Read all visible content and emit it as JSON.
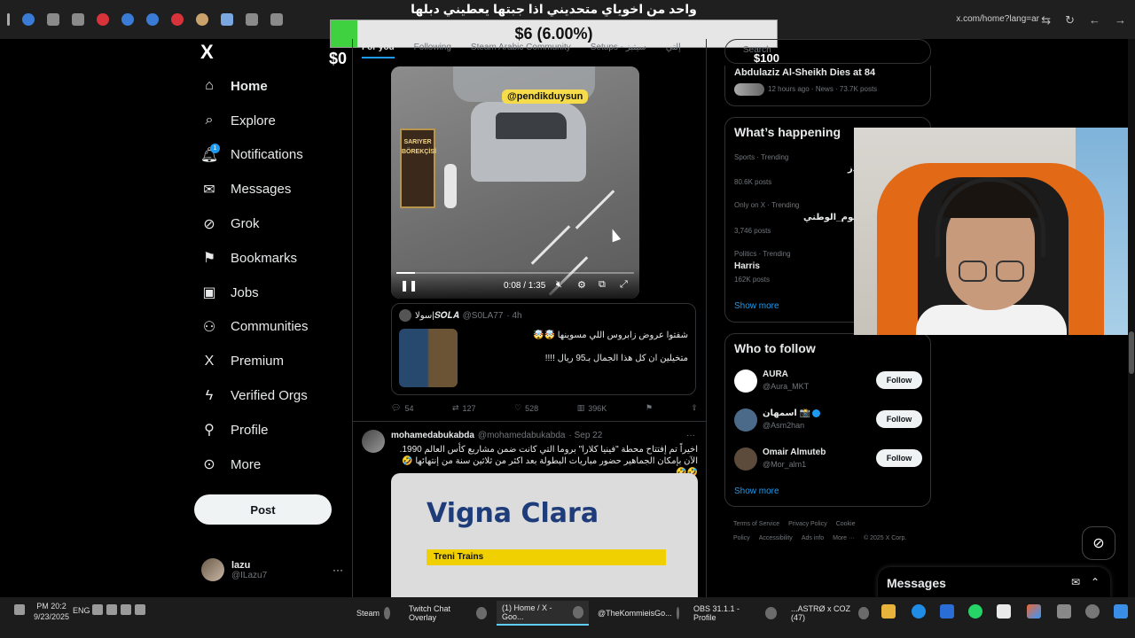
{
  "browser": {
    "url": "x.com/home?lang=ar",
    "stream_title": "واحد من اخوياي متحديني اذا جبتها يعطيني دبلها"
  },
  "goal": {
    "label": "$6 (6.00%)",
    "percent": 6,
    "min_label": "$0",
    "max_label": "$100"
  },
  "nav": {
    "logo": "X",
    "items": [
      {
        "label": "Home",
        "icon": "home-icon",
        "glyph": "⌂"
      },
      {
        "label": "Explore",
        "icon": "search-icon",
        "glyph": "⌕"
      },
      {
        "label": "Notifications",
        "icon": "bell-icon",
        "glyph": "🔔︎"
      },
      {
        "label": "Messages",
        "icon": "mail-icon",
        "glyph": "✉"
      },
      {
        "label": "Grok",
        "icon": "grok-icon",
        "glyph": "⊘"
      },
      {
        "label": "Bookmarks",
        "icon": "bookmark-icon",
        "glyph": "⚑"
      },
      {
        "label": "Jobs",
        "icon": "briefcase-icon",
        "glyph": "▣"
      },
      {
        "label": "Communities",
        "icon": "people-icon",
        "glyph": "⚇"
      },
      {
        "label": "Premium",
        "icon": "x-premium-icon",
        "glyph": "X"
      },
      {
        "label": "Verified Orgs",
        "icon": "lightning-icon",
        "glyph": "ϟ"
      },
      {
        "label": "Profile",
        "icon": "person-icon",
        "glyph": "⚲"
      },
      {
        "label": "More",
        "icon": "more-circle-icon",
        "glyph": "⊙"
      }
    ],
    "notification_badge": "1",
    "post_button": "Post",
    "account_name": "lazu",
    "account_handle": "@ILazu7",
    "account_more": "···"
  },
  "feed": {
    "tabs": [
      "For you",
      "Following",
      "Steam Arabic Community",
      "Setups - سيتبز",
      "إلتي"
    ],
    "video": {
      "watermark": "@pendikduysun",
      "sign": "SARIYER BÖREKÇİSİ",
      "time": "0:08 / 1:35",
      "progress": 0.08
    },
    "quote": {
      "name": "سولا|𝑺𝑶𝑳𝑨",
      "handle": "@S0LA77",
      "time": "· 4h",
      "line1": "شفتوا عروض زابروس اللي مسوينها 🤯🤯",
      "line2": "متخيلين ان كل هذا الجمال بـ95 ريال !!!!"
    },
    "actions": {
      "replies": "54",
      "reposts": "127",
      "likes": "528",
      "views": "396K"
    },
    "post2": {
      "name": "mohamedabukabda",
      "handle": "@mohamedabukabda",
      "date": "· Sep 22",
      "more": "···",
      "body": "اخيراً تم إفتتاح محطة \"فينيا كلارا\" بروما التي كانت ضمن مشاريع كأس العالم 1990. الآن بإمكان الجماهير حضور مباريات البطولة بعد اكثر من ثلاثين سنة من إنتهائها 🤣🤣🤣",
      "image_text": "Vigna Clara",
      "image_band": "Treni  Trains"
    }
  },
  "sidebar": {
    "search_placeholder": "Search",
    "news": {
      "title": "Abdulaziz Al-Sheikh Dies at 84",
      "meta": "12 hours ago · News · 73.7K posts"
    },
    "happening": {
      "title": "What’s happening",
      "trends": [
        {
          "category": "Sports · Trending",
          "name": "دز",
          "posts": "80.6K posts"
        },
        {
          "category": "Only on X · Trending",
          "name": "يوم_الوطني",
          "posts": "3,746 posts"
        },
        {
          "category": "Politics · Trending",
          "name": "Harris",
          "posts": "162K posts"
        }
      ],
      "show_more": "Show more"
    },
    "who_to_follow": {
      "title": "Who to follow",
      "accounts": [
        {
          "name": "AURA",
          "handle": "@Aura_MKT",
          "button": "Follow"
        },
        {
          "name": "اسمهان 📸",
          "handle": "@Asm2han",
          "button": "Follow"
        },
        {
          "name": "Omair Almuteb",
          "handle": "@Mor_alm1",
          "button": "Follow"
        }
      ],
      "show_more": "Show more"
    },
    "footer": [
      "Terms of Service",
      "Privacy Policy",
      "Cookie Policy",
      "Accessibility",
      "Ads info",
      "More ···",
      "© 2025 X Corp."
    ]
  },
  "messages_dock": {
    "title": "Messages"
  },
  "taskbar": {
    "time": "PM 20:2",
    "date": "9/23/2025",
    "lang": "ENG",
    "tasks": [
      {
        "label": "Steam"
      },
      {
        "label": "Twitch Chat Overlay"
      },
      {
        "label": "(1) Home / X - Goo..."
      },
      {
        "label": "@TheKommieisGo..."
      },
      {
        "label": "OBS 31.1.1 - Profile"
      },
      {
        "label": "...ASTRØ x COZ (47)"
      }
    ]
  },
  "colors": {
    "accent": "#1d9bf0",
    "goal_fill": "#3fd13f",
    "background": "#000000"
  }
}
